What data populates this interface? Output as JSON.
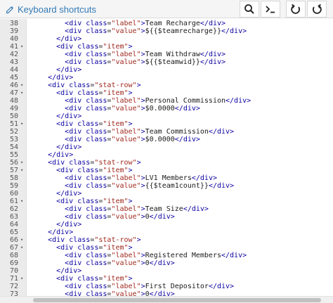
{
  "toolbar": {
    "shortcuts_label": "Keyboard shortcuts",
    "buttons": [
      {
        "name": "search-button",
        "icon": "search-icon"
      },
      {
        "name": "command-button",
        "icon": "terminal-icon"
      },
      {
        "name": "undo-button",
        "icon": "undo-icon"
      },
      {
        "name": "redo-button",
        "icon": "redo-icon"
      }
    ]
  },
  "editor": {
    "lines": [
      {
        "n": "38",
        "fold": false,
        "code": "        <div class=\"label\">Team Recharge</div>"
      },
      {
        "n": "39",
        "fold": false,
        "code": "        <div class=\"value\">${{$teamrecharge}}</div>"
      },
      {
        "n": "40",
        "fold": false,
        "code": "      </div>"
      },
      {
        "n": "41",
        "fold": true,
        "code": "      <div class=\"item\">"
      },
      {
        "n": "42",
        "fold": false,
        "code": "        <div class=\"label\">Team Withdraw</div>"
      },
      {
        "n": "43",
        "fold": false,
        "code": "        <div class=\"value\">${{$teamwid}}</div>"
      },
      {
        "n": "44",
        "fold": false,
        "code": "      </div>"
      },
      {
        "n": "45",
        "fold": false,
        "code": "    </div>"
      },
      {
        "n": "46",
        "fold": true,
        "code": "    <div class=\"stat-row\">"
      },
      {
        "n": "47",
        "fold": true,
        "code": "      <div class=\"item\">"
      },
      {
        "n": "48",
        "fold": false,
        "code": "        <div class=\"label\">Personal Commission</div>"
      },
      {
        "n": "49",
        "fold": false,
        "code": "        <div class=\"value\">$0.0000</div>"
      },
      {
        "n": "50",
        "fold": false,
        "code": "      </div>"
      },
      {
        "n": "51",
        "fold": true,
        "code": "      <div class=\"item\">"
      },
      {
        "n": "52",
        "fold": false,
        "code": "        <div class=\"label\">Team Commission</div>"
      },
      {
        "n": "53",
        "fold": false,
        "code": "        <div class=\"value\">$0.0000</div>"
      },
      {
        "n": "54",
        "fold": false,
        "code": "      </div>"
      },
      {
        "n": "55",
        "fold": false,
        "code": "    </div>"
      },
      {
        "n": "56",
        "fold": true,
        "code": "    <div class=\"stat-row\">"
      },
      {
        "n": "57",
        "fold": true,
        "code": "      <div class=\"item\">"
      },
      {
        "n": "58",
        "fold": false,
        "code": "        <div class=\"label\">LV1 Members</div>"
      },
      {
        "n": "59",
        "fold": false,
        "code": "        <div class=\"value\">{{$team1count}}</div>"
      },
      {
        "n": "60",
        "fold": false,
        "code": "      </div>"
      },
      {
        "n": "61",
        "fold": true,
        "code": "      <div class=\"item\">"
      },
      {
        "n": "62",
        "fold": false,
        "code": "        <div class=\"label\">Team Size</div>"
      },
      {
        "n": "63",
        "fold": false,
        "code": "        <div class=\"value\">0</div>"
      },
      {
        "n": "64",
        "fold": false,
        "code": "      </div>"
      },
      {
        "n": "65",
        "fold": false,
        "code": "    </div>"
      },
      {
        "n": "66",
        "fold": true,
        "code": "    <div class=\"stat-row\">"
      },
      {
        "n": "67",
        "fold": true,
        "code": "      <div class=\"item\">"
      },
      {
        "n": "68",
        "fold": false,
        "code": "        <div class=\"label\">Registered Members</div>"
      },
      {
        "n": "69",
        "fold": false,
        "code": "        <div class=\"value\">0</div>"
      },
      {
        "n": "70",
        "fold": false,
        "code": "      </div>"
      },
      {
        "n": "71",
        "fold": true,
        "code": "      <div class=\"item\">"
      },
      {
        "n": "72",
        "fold": false,
        "code": "        <div class=\"label\">First Depositor</div>"
      },
      {
        "n": "73",
        "fold": false,
        "code": "        <div class=\"value\">0</div>"
      }
    ]
  }
}
